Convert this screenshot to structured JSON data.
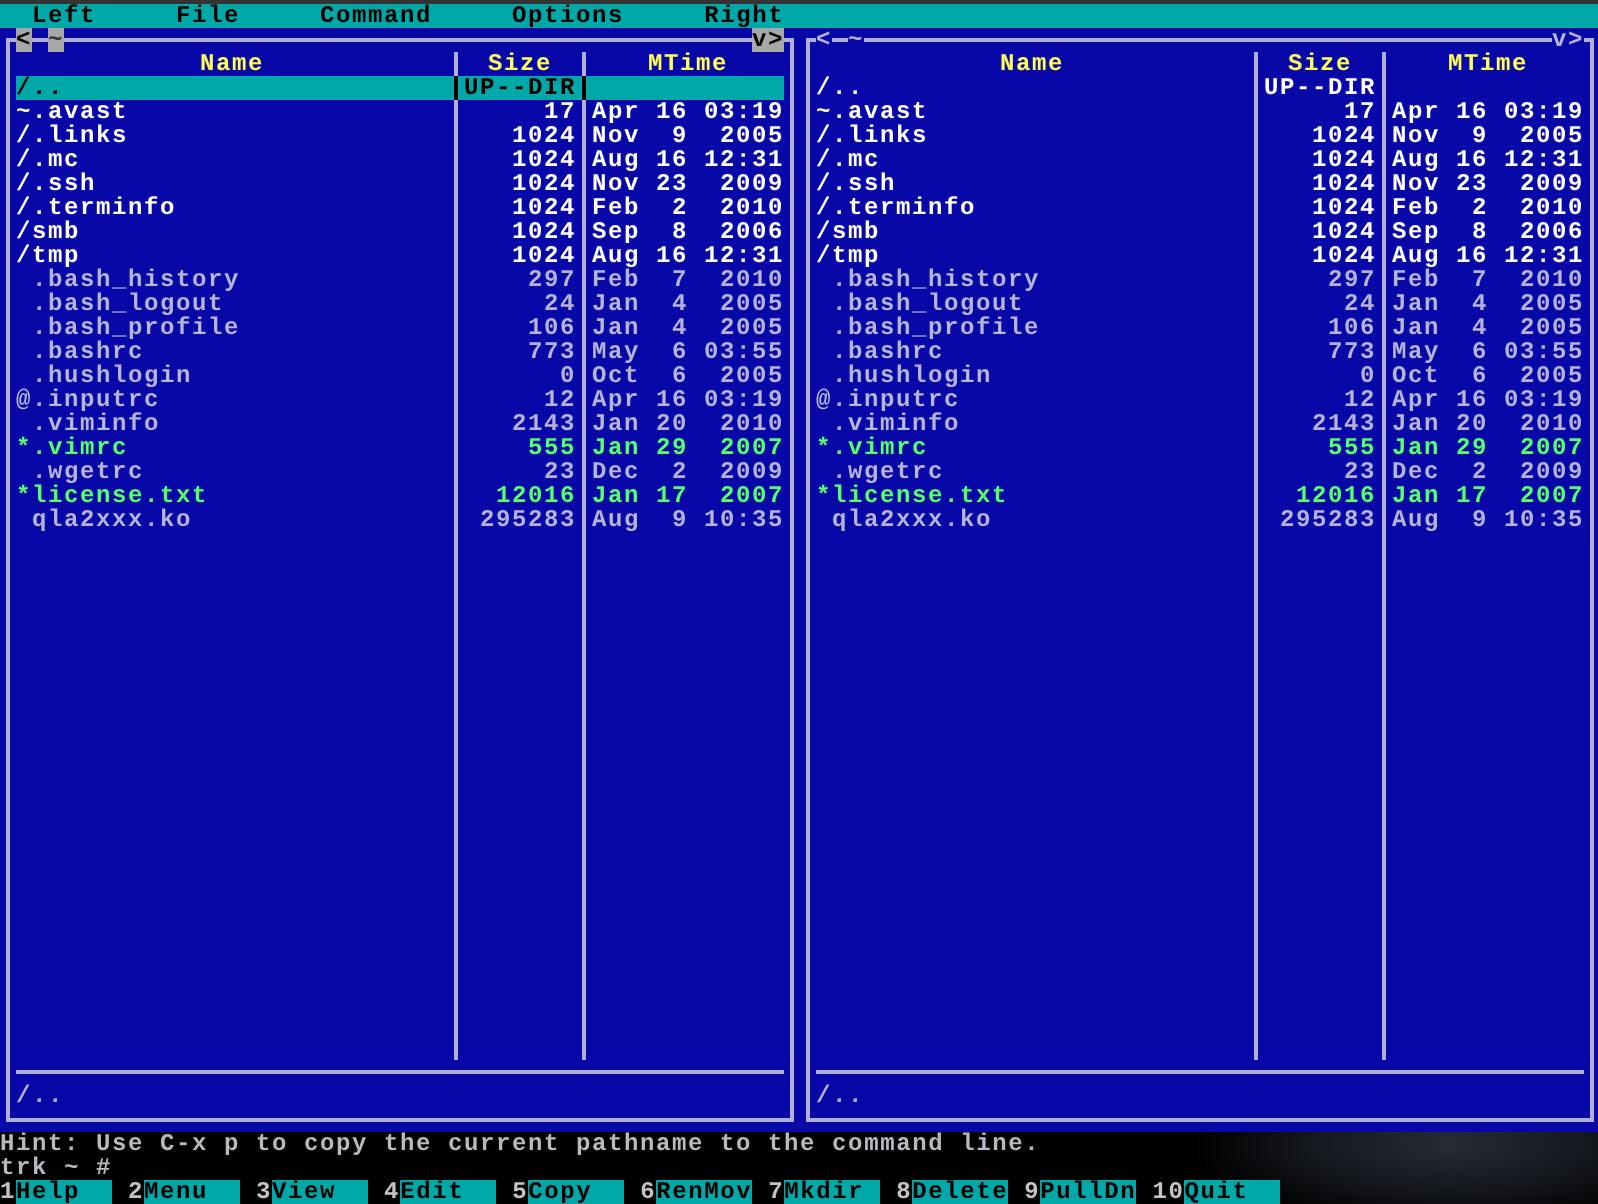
{
  "menu_bar": [
    "Left",
    "File",
    "Command",
    "Options",
    "Right"
  ],
  "panels": [
    {
      "active": true,
      "back": "<",
      "path": "~",
      "history": "v",
      "forward": ">",
      "columns": [
        "Name",
        "Size",
        "MTime"
      ],
      "entries": [
        {
          "name": "/..",
          "kind": "updir",
          "size": "UP--DIR",
          "selected": true
        },
        {
          "name": "~.avast",
          "kind": "dirlink",
          "size": "17",
          "mtime": "Apr 16 03:19",
          "selected": false
        },
        {
          "name": "/.links",
          "kind": "dir",
          "size": "1024",
          "mtime": "Nov  9  2005",
          "selected": false
        },
        {
          "name": "/.mc",
          "kind": "dir",
          "size": "1024",
          "mtime": "Aug 16 12:31",
          "selected": false
        },
        {
          "name": "/.ssh",
          "kind": "dir",
          "size": "1024",
          "mtime": "Nov 23  2009",
          "selected": false
        },
        {
          "name": "/.terminfo",
          "kind": "dir",
          "size": "1024",
          "mtime": "Feb  2  2010",
          "selected": false
        },
        {
          "name": "/smb",
          "kind": "dir",
          "size": "1024",
          "mtime": "Sep  8  2006",
          "selected": false
        },
        {
          "name": "/tmp",
          "kind": "dir",
          "size": "1024",
          "mtime": "Aug 16 12:31",
          "selected": false
        },
        {
          "name": ".bash_history",
          "kind": "file",
          "size": "297",
          "mtime": "Feb  7  2010",
          "selected": false
        },
        {
          "name": ".bash_logout",
          "kind": "file",
          "size": "24",
          "mtime": "Jan  4  2005",
          "selected": false
        },
        {
          "name": ".bash_profile",
          "kind": "file",
          "size": "106",
          "mtime": "Jan  4  2005",
          "selected": false
        },
        {
          "name": ".bashrc",
          "kind": "file",
          "size": "773",
          "mtime": "May  6 03:55",
          "selected": false
        },
        {
          "name": ".hushlogin",
          "kind": "file",
          "size": "0",
          "mtime": "Oct  6  2005",
          "selected": false
        },
        {
          "name": "@.inputrc",
          "kind": "link",
          "size": "12",
          "mtime": "Apr 16 03:19",
          "selected": false
        },
        {
          "name": ".viminfo",
          "kind": "file",
          "size": "2143",
          "mtime": "Jan 20  2010",
          "selected": false
        },
        {
          "name": "*.vimrc",
          "kind": "exec",
          "size": "555",
          "mtime": "Jan 29  2007",
          "selected": false
        },
        {
          "name": ".wgetrc",
          "kind": "file",
          "size": "23",
          "mtime": "Dec  2  2009",
          "selected": false
        },
        {
          "name": "*license.txt",
          "kind": "exec",
          "size": "12016",
          "mtime": "Jan 17  2007",
          "selected": false
        },
        {
          "name": "qla2xxx.ko",
          "kind": "file",
          "size": "295283",
          "mtime": "Aug  9 10:35",
          "selected": false
        }
      ],
      "mini_status": "/.."
    },
    {
      "active": false,
      "back": "<",
      "path": "~",
      "history": "v",
      "forward": ">",
      "columns": [
        "Name",
        "Size",
        "MTime"
      ],
      "entries": [
        {
          "name": "/..",
          "kind": "updir",
          "size": "UP--DIR",
          "selected": false
        },
        {
          "name": "~.avast",
          "kind": "dirlink",
          "size": "17",
          "mtime": "Apr 16 03:19",
          "selected": false
        },
        {
          "name": "/.links",
          "kind": "dir",
          "size": "1024",
          "mtime": "Nov  9  2005",
          "selected": false
        },
        {
          "name": "/.mc",
          "kind": "dir",
          "size": "1024",
          "mtime": "Aug 16 12:31",
          "selected": false
        },
        {
          "name": "/.ssh",
          "kind": "dir",
          "size": "1024",
          "mtime": "Nov 23  2009",
          "selected": false
        },
        {
          "name": "/.terminfo",
          "kind": "dir",
          "size": "1024",
          "mtime": "Feb  2  2010",
          "selected": false
        },
        {
          "name": "/smb",
          "kind": "dir",
          "size": "1024",
          "mtime": "Sep  8  2006",
          "selected": false
        },
        {
          "name": "/tmp",
          "kind": "dir",
          "size": "1024",
          "mtime": "Aug 16 12:31",
          "selected": false
        },
        {
          "name": ".bash_history",
          "kind": "file",
          "size": "297",
          "mtime": "Feb  7  2010",
          "selected": false
        },
        {
          "name": ".bash_logout",
          "kind": "file",
          "size": "24",
          "mtime": "Jan  4  2005",
          "selected": false
        },
        {
          "name": ".bash_profile",
          "kind": "file",
          "size": "106",
          "mtime": "Jan  4  2005",
          "selected": false
        },
        {
          "name": ".bashrc",
          "kind": "file",
          "size": "773",
          "mtime": "May  6 03:55",
          "selected": false
        },
        {
          "name": ".hushlogin",
          "kind": "file",
          "size": "0",
          "mtime": "Oct  6  2005",
          "selected": false
        },
        {
          "name": "@.inputrc",
          "kind": "link",
          "size": "12",
          "mtime": "Apr 16 03:19",
          "selected": false
        },
        {
          "name": ".viminfo",
          "kind": "file",
          "size": "2143",
          "mtime": "Jan 20  2010",
          "selected": false
        },
        {
          "name": "*.vimrc",
          "kind": "exec",
          "size": "555",
          "mtime": "Jan 29  2007",
          "selected": false
        },
        {
          "name": ".wgetrc",
          "kind": "file",
          "size": "23",
          "mtime": "Dec  2  2009",
          "selected": false
        },
        {
          "name": "*license.txt",
          "kind": "exec",
          "size": "12016",
          "mtime": "Jan 17  2007",
          "selected": false
        },
        {
          "name": "qla2xxx.ko",
          "kind": "file",
          "size": "295283",
          "mtime": "Aug  9 10:35",
          "selected": false
        }
      ],
      "mini_status": "/.."
    }
  ],
  "hint": "Hint: Use C-x p to copy the current pathname to the command line.",
  "prompt": "trk ~ #",
  "function_keys": [
    {
      "number": "1",
      "label": "Help"
    },
    {
      "number": "2",
      "label": "Menu"
    },
    {
      "number": "3",
      "label": "View"
    },
    {
      "number": "4",
      "label": "Edit"
    },
    {
      "number": "5",
      "label": "Copy"
    },
    {
      "number": "6",
      "label": "RenMov"
    },
    {
      "number": "7",
      "label": "Mkdir"
    },
    {
      "number": "8",
      "label": "Delete"
    },
    {
      "number": "9",
      "label": "PullDn"
    },
    {
      "number": "10",
      "label": "Quit"
    }
  ]
}
